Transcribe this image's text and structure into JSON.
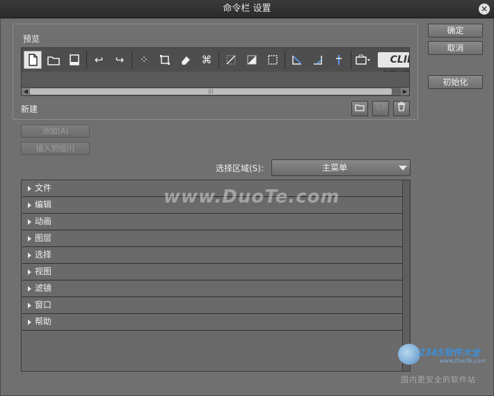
{
  "window": {
    "title": "命令栏 设置",
    "close_label": "✕"
  },
  "right_buttons": {
    "ok": "确定",
    "cancel": "取消",
    "reset": "初始化"
  },
  "preview": {
    "label": "预览",
    "toolbar_icons": [
      "new-file-icon",
      "open-folder-icon",
      "save-icon",
      "undo-icon",
      "redo-icon",
      "dots-icon",
      "transform-icon",
      "eraser-icon",
      "crop-icon",
      "pen-icon",
      "gradient-icon",
      "select-rect-icon",
      "ruler-icon",
      "angle-icon",
      "pin-icon",
      "camera-icon"
    ],
    "logo_text": "CLIP STUDIO",
    "scroll_grip": "|||",
    "selected_command_label": "新建"
  },
  "actions": {
    "add": "添加(A)",
    "insert_group": "插入到组(I)"
  },
  "select_area": {
    "label": "选择区域(S):",
    "value": "主菜单"
  },
  "menu_items": [
    {
      "label": "文件"
    },
    {
      "label": "编辑"
    },
    {
      "label": "动画"
    },
    {
      "label": "图层"
    },
    {
      "label": "选择"
    },
    {
      "label": "视图"
    },
    {
      "label": "滤镜"
    },
    {
      "label": "窗口"
    },
    {
      "label": "帮助"
    }
  ],
  "watermark": {
    "text": "www.DuoTe.com",
    "brand": "2345软件大全",
    "site": "www.DuoTe.com",
    "slogan": "国内更安全的软件站"
  },
  "colors": {
    "panel": "#707070",
    "titlebar": "#2b2b2b",
    "text": "#f0f0f0",
    "disabled_text": "#9c9c9c",
    "toolbar_bg": "#4e4e4e"
  }
}
